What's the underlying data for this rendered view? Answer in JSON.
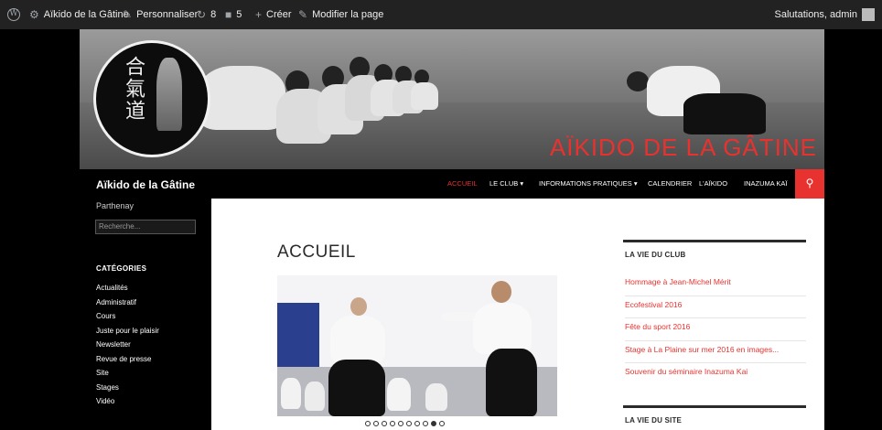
{
  "adminbar": {
    "wp_icon": "wordpress-icon",
    "site_name": "Aïkido de la Gâtine",
    "customize": "Personnaliser",
    "updates": "8",
    "comments": "5",
    "new": "Créer",
    "edit": "Modifier la page",
    "greeting": "Salutations, admin"
  },
  "header": {
    "title": "AÏKIDO DE LA GÂTINE",
    "logo_text": "合氣道"
  },
  "site": {
    "title": "Aïkido de la Gâtine",
    "tagline": "Parthenay"
  },
  "search": {
    "placeholder": "Recherche..."
  },
  "nav": {
    "items": [
      "ACCUEIL",
      "LE CLUB",
      "INFORMATIONS PRATIQUES",
      "CALENDRIER",
      "L'AÏKIDO",
      "INAZUMA KAÏ"
    ],
    "active": "ACCUEIL"
  },
  "categories": {
    "title": "CATÉGORIES",
    "items": [
      "Actualités",
      "Administratif",
      "Cours",
      "Juste pour le plaisir",
      "Newsletter",
      "Revue de presse",
      "Site",
      "Stages",
      "Vidéo"
    ]
  },
  "page": {
    "title": "ACCUEIL"
  },
  "slider": {
    "dot_count": 10,
    "active_dot": 9
  },
  "widgets": {
    "club_title": "LA VIE DU CLUB",
    "club_posts": [
      "Hommage à Jean-Michel Mérit",
      "Ecofestival 2016",
      "Fête du sport 2016",
      "Stage à La Plaine sur mer 2016 en images...",
      "Souvenir du séminaire Inazuma Kai"
    ],
    "site_title": "LA VIE DU SITE"
  },
  "colors": {
    "accent": "#e8322f",
    "adminbar": "#222222",
    "background": "#000000"
  }
}
